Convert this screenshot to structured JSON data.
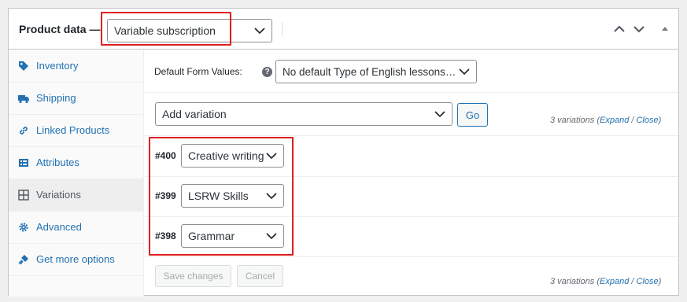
{
  "header": {
    "title": "Product data —",
    "product_type": "Variable subscription"
  },
  "tabs": [
    {
      "label": "Inventory",
      "icon": "tag-icon"
    },
    {
      "label": "Shipping",
      "icon": "truck-icon"
    },
    {
      "label": "Linked Products",
      "icon": "link-icon"
    },
    {
      "label": "Attributes",
      "icon": "list-icon"
    },
    {
      "label": "Variations",
      "icon": "grid-icon",
      "active": true
    },
    {
      "label": "Advanced",
      "icon": "gear-icon"
    },
    {
      "label": "Get more options",
      "icon": "plugin-icon"
    }
  ],
  "defaults": {
    "label": "Default Form Values:",
    "help": "?",
    "value": "No default Type of English lessons…"
  },
  "actions": {
    "select_value": "Add variation",
    "go_label": "Go"
  },
  "summary": {
    "count": "3 variations",
    "open_paren": "(",
    "expand": "Expand",
    "slash": " / ",
    "close": "Close",
    "close_paren": ")"
  },
  "variations": [
    {
      "id": "#400",
      "value": "Creative writing"
    },
    {
      "id": "#399",
      "value": "LSRW Skills"
    },
    {
      "id": "#398",
      "value": "Grammar"
    }
  ],
  "footer": {
    "save_label": "Save changes",
    "cancel_label": "Cancel"
  },
  "colors": {
    "accent": "#2271b1",
    "highlight": "#e01e1e"
  }
}
